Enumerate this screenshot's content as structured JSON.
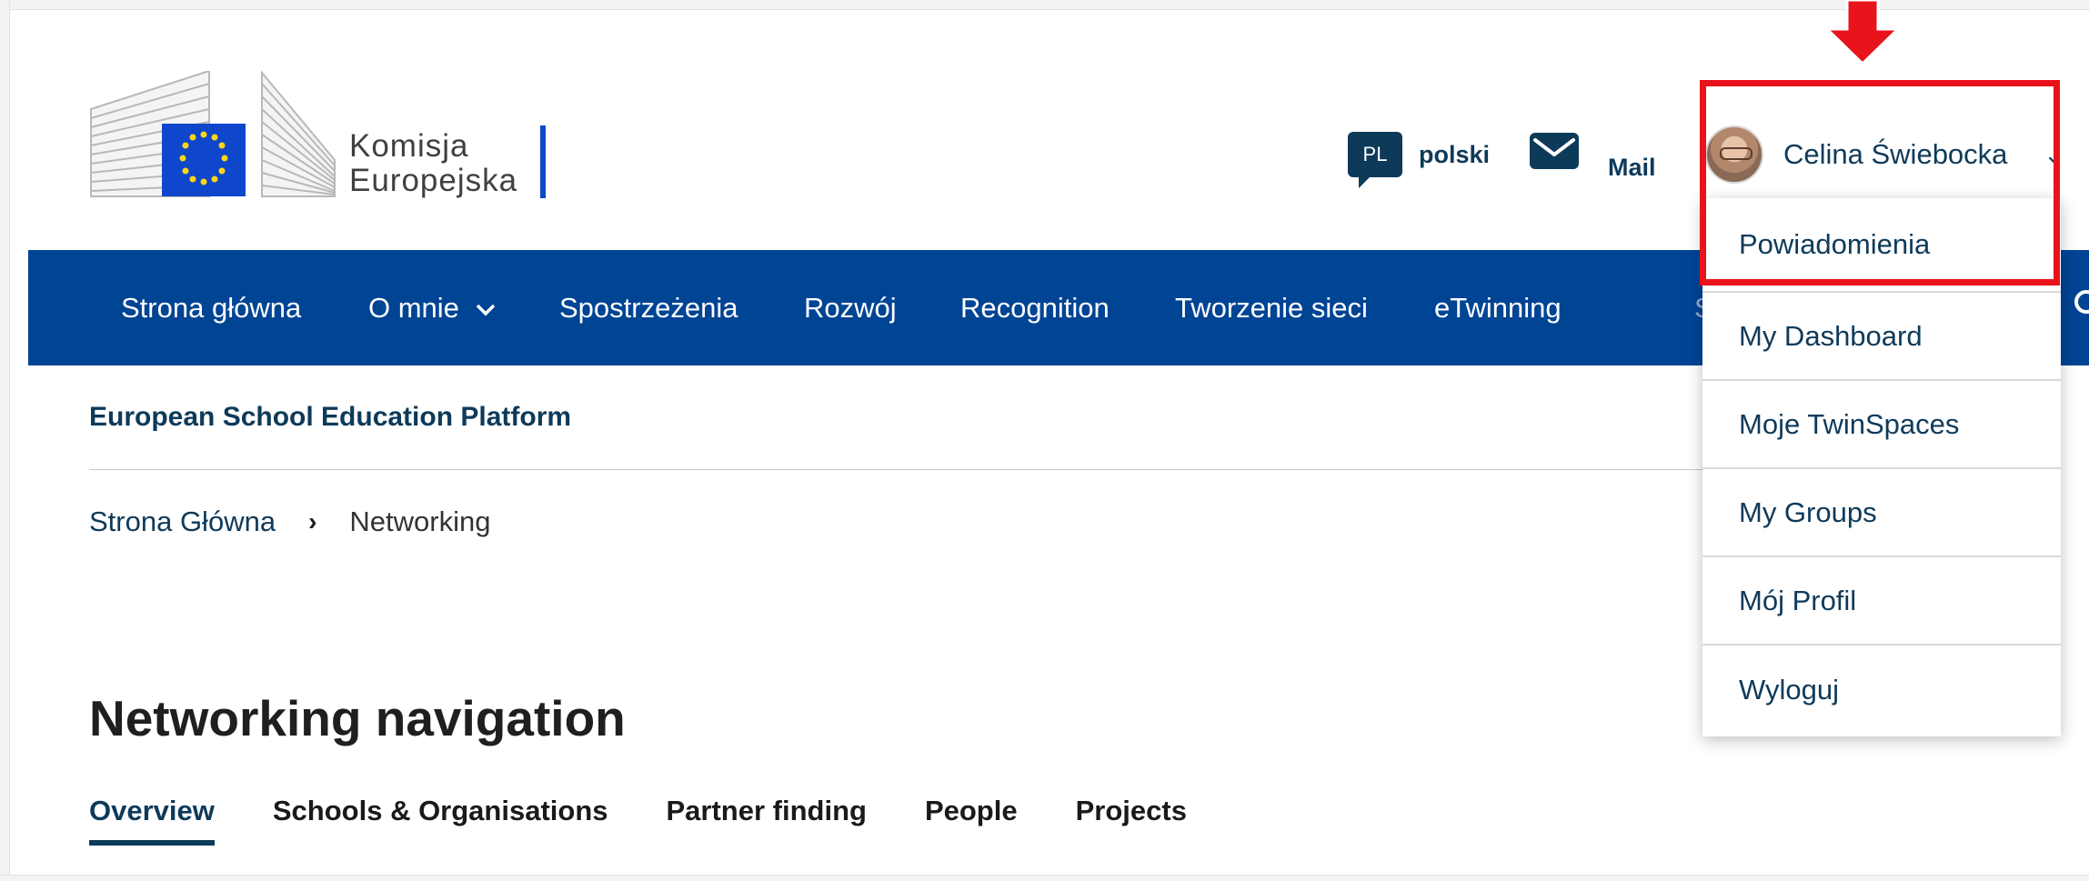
{
  "logo": {
    "line1": "Komisja",
    "line2": "Europejska"
  },
  "header": {
    "lang_code": "PL",
    "lang_label": "polski",
    "mail_label": "Mail",
    "user_name": "Celina Świebocka"
  },
  "nav": {
    "items": [
      "Strona główna",
      "O mnie",
      "Spostrzeżenia",
      "Rozwój",
      "Recognition",
      "Tworzenie sieci",
      "eTwinning"
    ],
    "search_placeholder": "Se"
  },
  "site_title": "European School Education Platform",
  "breadcrumb": {
    "home": "Strona Główna",
    "current": "Networking"
  },
  "page_title": "Networking navigation",
  "tabs": [
    "Overview",
    "Schools & Organisations",
    "Partner finding",
    "People",
    "Projects"
  ],
  "user_menu": [
    "Powiadomienia",
    "My Dashboard",
    "Moje TwinSpaces",
    "My Groups",
    "Mój Profil",
    "Wyloguj"
  ],
  "colors": {
    "nav_bg": "#004494",
    "accent": "#0e3a5a",
    "highlight": "#e8131b"
  }
}
